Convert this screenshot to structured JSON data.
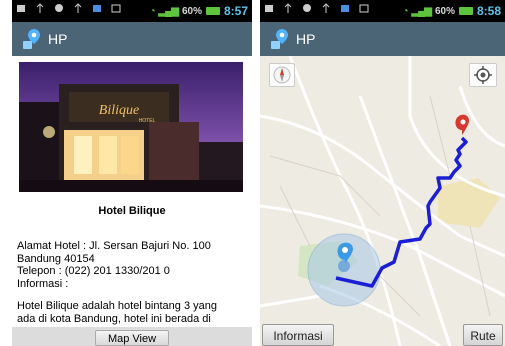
{
  "left_screen": {
    "status": {
      "battery": "60%",
      "time": "8:57"
    },
    "action_bar": {
      "title": "HP"
    },
    "hotel": {
      "name": "Hotel Bilique",
      "photo_sign": "Bilique Hotel",
      "address_line1": "Alamat Hotel : Jl. Sersan Bajuri No. 100",
      "address_line2": "Bandung 40154",
      "phone": "Telepon : (022) 201 1330/201 0",
      "info_label": "Informasi :",
      "description_line1": "Hotel Bilique adalah hotel bintang 3 yang",
      "description_line2": "ada di kota Bandung, hotel ini berada di"
    },
    "map_view_button": "Map View"
  },
  "right_screen": {
    "status": {
      "battery": "60%",
      "time": "8:58"
    },
    "action_bar": {
      "title": "HP"
    },
    "buttons": {
      "informasi": "Informasi",
      "rute": "Rute"
    },
    "colors": {
      "route": "#1a1fd6",
      "destination_pin": "#d63a2f",
      "user_pin": "#3b9be6"
    }
  },
  "colors": {
    "action_bar": "#4c6576",
    "status_bar": "#000000",
    "map_background": "#eeebe3"
  }
}
